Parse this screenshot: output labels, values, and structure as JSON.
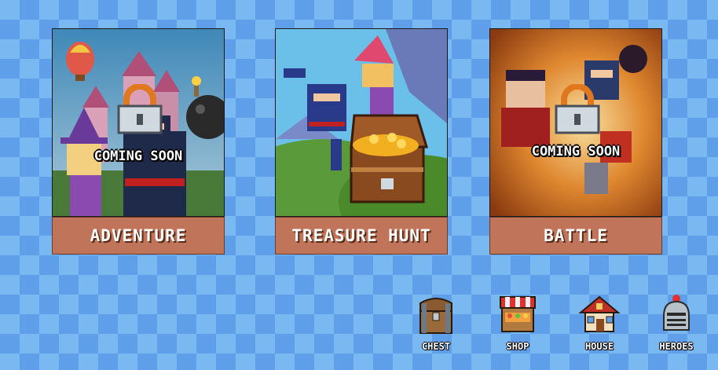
{
  "modes": [
    {
      "id": "adventure",
      "label": "ADVENTURE",
      "locked": true,
      "overlay": "COMING SOON"
    },
    {
      "id": "treasure-hunt",
      "label": "TREASURE HUNT",
      "locked": false,
      "overlay": ""
    },
    {
      "id": "battle",
      "label": "BATTLE",
      "locked": true,
      "overlay": "COMING SOON"
    }
  ],
  "nav": {
    "chest": {
      "label": "CHEST",
      "icon": "chest-icon"
    },
    "shop": {
      "label": "SHOP",
      "icon": "shop-icon"
    },
    "house": {
      "label": "HOUSE",
      "icon": "house-icon"
    },
    "heroes": {
      "label": "HEROES",
      "icon": "helmet-icon"
    }
  },
  "colors": {
    "background_light": "#7ab8f2",
    "background_dark": "#5f9ee8",
    "label_bg": "#c0755a",
    "label_text": "#ffffff"
  }
}
